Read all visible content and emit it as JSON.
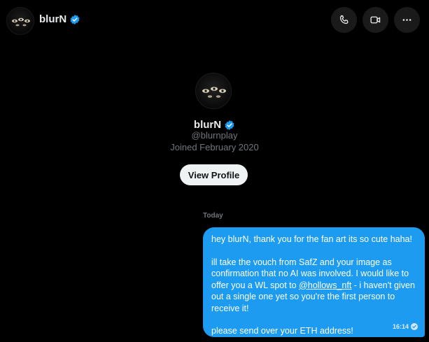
{
  "header": {
    "name": "blurN",
    "avatar_icon": "owl-eyes-avatar",
    "verified_icon": "verified-badge-icon",
    "actions": [
      {
        "name": "call-button",
        "icon": "phone-icon"
      },
      {
        "name": "video-button",
        "icon": "video-icon"
      },
      {
        "name": "more-button",
        "icon": "more-dots-icon"
      }
    ]
  },
  "profile": {
    "name": "blurN",
    "handle": "@blurnplay",
    "joined": "Joined February 2020",
    "view_profile_label": "View Profile"
  },
  "conversation": {
    "date_separator": "Today",
    "messages": [
      {
        "line1": "hey blurN, thank you for the fan art its so cute haha!",
        "line2_before": "ill take the vouch from SafZ and your image as confirmation that no AI was involved. I would like to offer you a WL spot to ",
        "line2_link": "@hollows_nft",
        "line2_after": " - i haven't given out a single one yet so you're the first person to receive it!",
        "line3": "please send over your ETH address!",
        "time": "16:14"
      }
    ]
  },
  "colors": {
    "background": "#000000",
    "bubble": "#1d9bf0",
    "verified": "#1d9bf0",
    "muted_text": "#71767b",
    "button_bg": "#eff3f4"
  }
}
